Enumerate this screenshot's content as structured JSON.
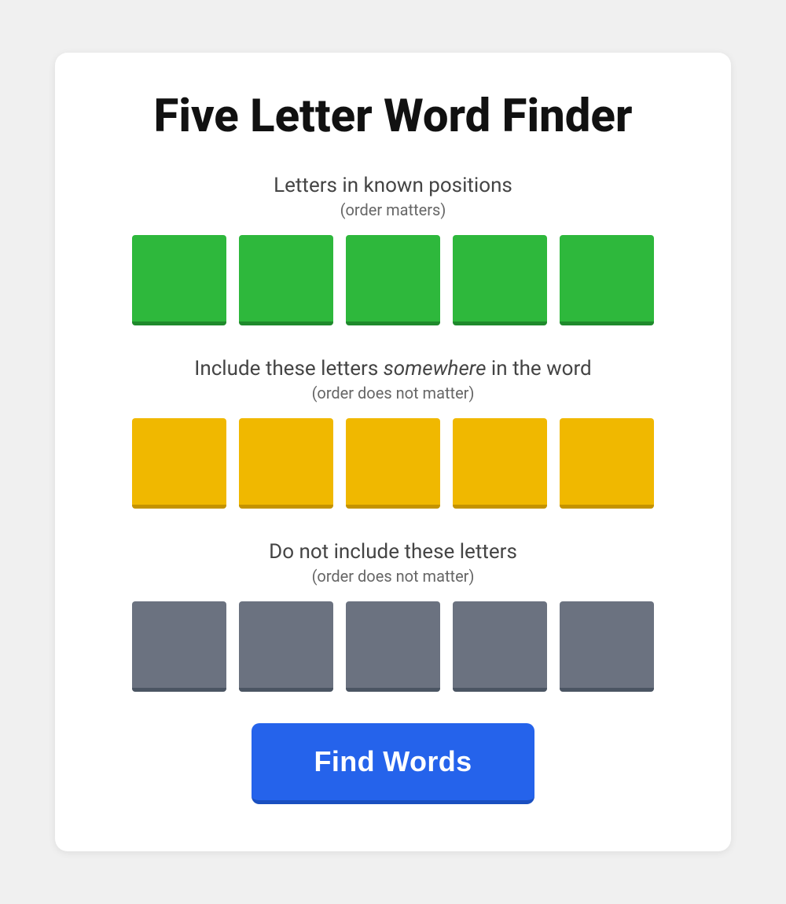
{
  "page": {
    "title": "Five Letter Word Finder",
    "card": {
      "section_known": {
        "label": "Letters in known positions",
        "sublabel": "(order matters)"
      },
      "section_include": {
        "label_prefix": "Include these letters ",
        "label_italic": "somewhere",
        "label_suffix": " in the word",
        "sublabel": "(order does not matter)"
      },
      "section_exclude": {
        "label": "Do not include these letters",
        "sublabel": "(order does not matter)"
      },
      "button": {
        "label": "Find Words"
      }
    }
  },
  "colors": {
    "green": "#2eb83c",
    "yellow": "#f0b800",
    "gray": "#6b7280",
    "button_blue": "#2563eb"
  }
}
